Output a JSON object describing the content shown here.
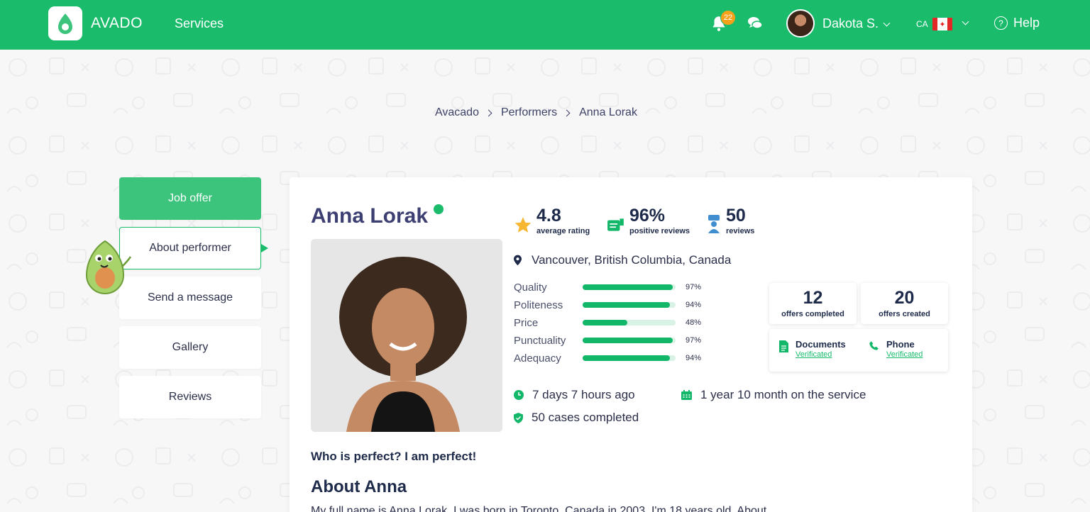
{
  "header": {
    "brand": "AVADO",
    "nav_services": "Services",
    "notifications_count": "22",
    "user_name": "Dakota S.",
    "lang_code": "CA",
    "help": "Help",
    "brand_color": "#1abc6c"
  },
  "breadcrumb": [
    "Avacado",
    "Performers",
    "Anna Lorak"
  ],
  "sidebar": {
    "items": [
      {
        "label": "Job offer"
      },
      {
        "label": "About performer"
      },
      {
        "label": "Send a message"
      },
      {
        "label": "Gallery"
      },
      {
        "label": "Reviews"
      }
    ]
  },
  "profile": {
    "name": "Anna Lorak",
    "online": true,
    "stats": {
      "rating": "4.8",
      "rating_label": "average rating",
      "positive": "96%",
      "positive_label": "positive reviews",
      "reviews": "50",
      "reviews_label": "reviews"
    },
    "location": "Vancouver, British Columbia, Canada",
    "ratings": [
      {
        "label": "Quality",
        "pct": "97%",
        "value": 0.97
      },
      {
        "label": "Politeness",
        "pct": "94%",
        "value": 0.94
      },
      {
        "label": "Price",
        "pct": "48%",
        "value": 0.48
      },
      {
        "label": "Punctuality",
        "pct": "97%",
        "value": 0.97
      },
      {
        "label": "Adequacy",
        "pct": "94%",
        "value": 0.94
      }
    ],
    "offers_completed": "12",
    "offers_completed_label": "offers completed",
    "offers_created": "20",
    "offers_created_label": "offers created",
    "documents_label": "Documents",
    "documents_status": "Verificated",
    "phone_label": "Phone",
    "phone_status": "Verificated",
    "last_seen": "7 days 7 hours ago",
    "on_service": "1 year 10 month on the service",
    "cases": "50 cases completed",
    "tagline": "Who is perfect? I am perfect!",
    "about_title": "About Anna",
    "about_text": "My full name is Anna Lorak. I was born in Toronto, Canada in 2003. I'm 18 years old. About"
  }
}
